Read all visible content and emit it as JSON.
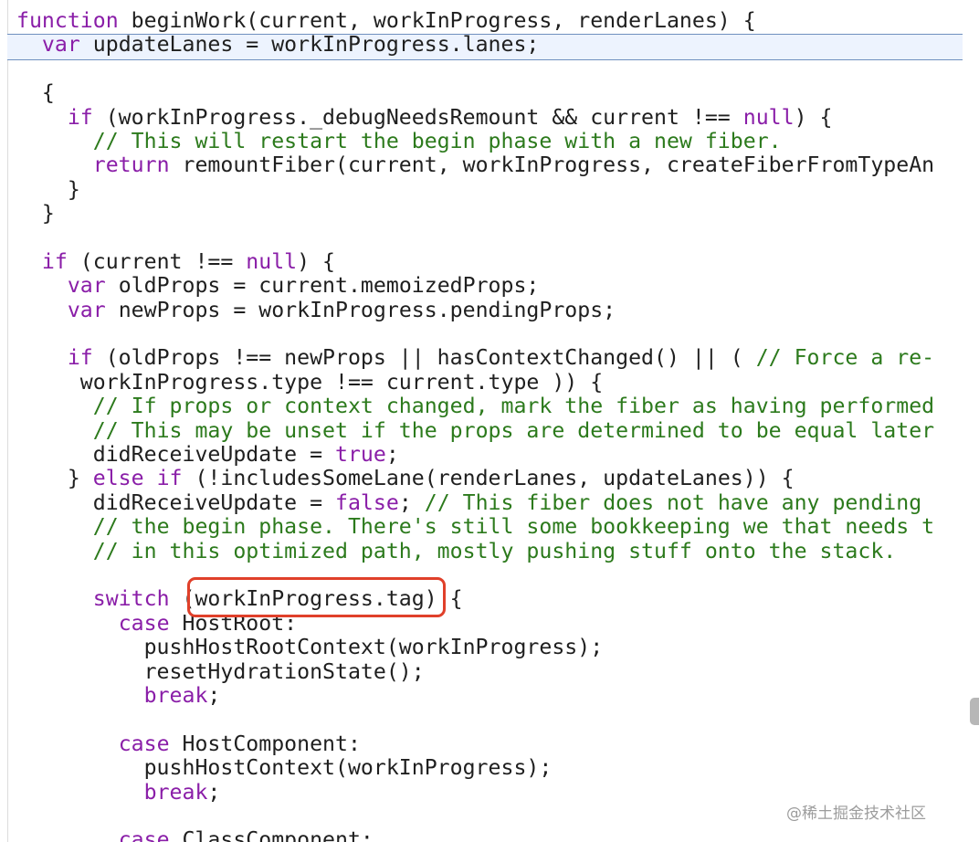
{
  "editor": {
    "lines": [
      [
        {
          "t": "function",
          "c": "kw"
        },
        {
          "t": " beginWork(current, workInProgress, renderLanes) {"
        }
      ],
      [
        {
          "t": "  "
        },
        {
          "t": "var",
          "c": "kw"
        },
        {
          "t": " updateLanes = workInProgress.lanes;"
        }
      ],
      [],
      [
        {
          "t": "  {"
        }
      ],
      [
        {
          "t": "    "
        },
        {
          "t": "if",
          "c": "kw"
        },
        {
          "t": " (workInProgress._debugNeedsRemount && current !== "
        },
        {
          "t": "null",
          "c": "lit"
        },
        {
          "t": ") {"
        }
      ],
      [
        {
          "t": "      "
        },
        {
          "t": "// This will restart the begin phase with a new fiber.",
          "c": "cmt"
        }
      ],
      [
        {
          "t": "      "
        },
        {
          "t": "return",
          "c": "kw"
        },
        {
          "t": " remountFiber(current, workInProgress, createFiberFromTypeAn"
        }
      ],
      [
        {
          "t": "    }"
        }
      ],
      [
        {
          "t": "  }"
        }
      ],
      [],
      [
        {
          "t": "  "
        },
        {
          "t": "if",
          "c": "kw"
        },
        {
          "t": " (current !== "
        },
        {
          "t": "null",
          "c": "lit"
        },
        {
          "t": ") {"
        }
      ],
      [
        {
          "t": "    "
        },
        {
          "t": "var",
          "c": "kw"
        },
        {
          "t": " oldProps = current.memoizedProps;"
        }
      ],
      [
        {
          "t": "    "
        },
        {
          "t": "var",
          "c": "kw"
        },
        {
          "t": " newProps = workInProgress.pendingProps;"
        }
      ],
      [],
      [
        {
          "t": "    "
        },
        {
          "t": "if",
          "c": "kw"
        },
        {
          "t": " (oldProps !== newProps || hasContextChanged() || ( "
        },
        {
          "t": "// Force a re-",
          "c": "cmt"
        }
      ],
      [
        {
          "t": "     workInProgress.type !== current.type )) {"
        }
      ],
      [
        {
          "t": "      "
        },
        {
          "t": "// If props or context changed, mark the fiber as having performed",
          "c": "cmt"
        }
      ],
      [
        {
          "t": "      "
        },
        {
          "t": "// This may be unset if the props are determined to be equal later",
          "c": "cmt"
        }
      ],
      [
        {
          "t": "      didReceiveUpdate = "
        },
        {
          "t": "true",
          "c": "lit"
        },
        {
          "t": ";"
        }
      ],
      [
        {
          "t": "    } "
        },
        {
          "t": "else",
          "c": "kw"
        },
        {
          "t": " "
        },
        {
          "t": "if",
          "c": "kw"
        },
        {
          "t": " (!includesSomeLane(renderLanes, updateLanes)) {"
        }
      ],
      [
        {
          "t": "      didReceiveUpdate = "
        },
        {
          "t": "false",
          "c": "lit"
        },
        {
          "t": "; "
        },
        {
          "t": "// This fiber does not have any pending",
          "c": "cmt"
        }
      ],
      [
        {
          "t": "      "
        },
        {
          "t": "// the begin phase. There's still some bookkeeping we that needs t",
          "c": "cmt"
        }
      ],
      [
        {
          "t": "      "
        },
        {
          "t": "// in this optimized path, mostly pushing stuff onto the stack.",
          "c": "cmt"
        }
      ],
      [],
      [
        {
          "t": "      "
        },
        {
          "t": "switch",
          "c": "kw"
        },
        {
          "t": " (workInProgress.tag) {"
        }
      ],
      [
        {
          "t": "        "
        },
        {
          "t": "case",
          "c": "kw"
        },
        {
          "t": " HostRoot:"
        }
      ],
      [
        {
          "t": "          pushHostRootContext(workInProgress);"
        }
      ],
      [
        {
          "t": "          resetHydrationState();"
        }
      ],
      [
        {
          "t": "          "
        },
        {
          "t": "break",
          "c": "kw"
        },
        {
          "t": ";"
        }
      ],
      [],
      [
        {
          "t": "        "
        },
        {
          "t": "case",
          "c": "kw"
        },
        {
          "t": " HostComponent:"
        }
      ],
      [
        {
          "t": "          pushHostContext(workInProgress);"
        }
      ],
      [
        {
          "t": "          "
        },
        {
          "t": "break",
          "c": "kw"
        },
        {
          "t": ";"
        }
      ],
      [],
      [
        {
          "t": "        "
        },
        {
          "t": "case",
          "c": "kw"
        },
        {
          "t": " ClassComponent:"
        }
      ]
    ]
  },
  "watermark": "@稀土掘金技术社区",
  "colors": {
    "keyword": "#8a1ea8",
    "comment": "#2c7a1c",
    "text": "#1f1f1f",
    "current_line_bg": "#edf3fe",
    "annotation_box": "#e0402a"
  }
}
